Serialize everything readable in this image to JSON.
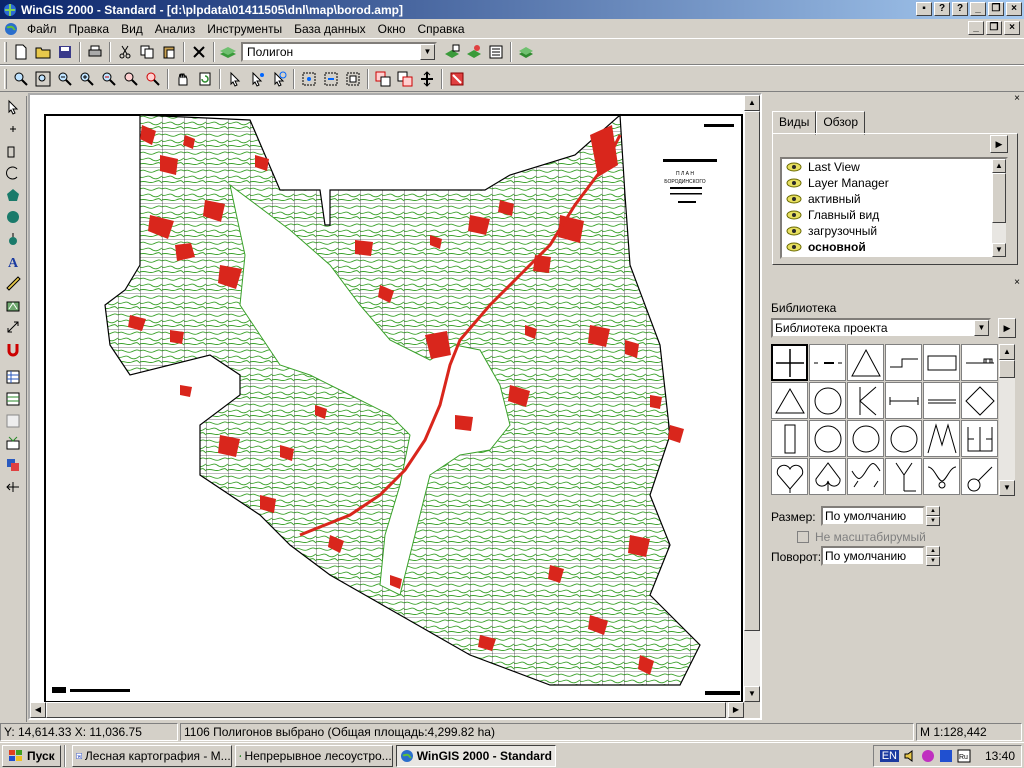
{
  "window": {
    "title": "WinGIS 2000 - Standard - [d:\\plpdata\\01411505\\dnl\\map\\borod.amp]"
  },
  "menu": [
    "Файл",
    "Правка",
    "Вид",
    "Анализ",
    "Инструменты",
    "База данных",
    "Окно",
    "Справка"
  ],
  "toolbar": {
    "layer_combo_value": "Полигон"
  },
  "map": {
    "title_line1": "П Л А Н",
    "title_line2": "БОРОДИНСКОГО"
  },
  "views_panel": {
    "tabs": [
      "Виды",
      "Обзор"
    ],
    "items": [
      {
        "label": "Last View",
        "bold": false
      },
      {
        "label": "Layer Manager",
        "bold": false
      },
      {
        "label": "активный",
        "bold": false
      },
      {
        "label": "Главный вид",
        "bold": false
      },
      {
        "label": "загрузочный",
        "bold": false
      },
      {
        "label": "основной",
        "bold": true
      }
    ]
  },
  "library_panel": {
    "label": "Библиотека",
    "combo_value": "Библиотека проекта",
    "size_label": "Размер:",
    "size_value": "По умолчанию",
    "no_scale_label": "Не масштабирумый",
    "rotation_label": "Поворот:",
    "rotation_value": "По умолчанию"
  },
  "status": {
    "coords": "Y: 14,614.33 X: 11,036.75",
    "selection": "1106 Полигонов выбрано (Общая площадь:4,299.82 ha)",
    "scale": "M 1:128,442"
  },
  "taskbar": {
    "start": "Пуск",
    "tasks": [
      "Лесная картография - М...",
      "Непрерывное лесоустро...",
      "WinGIS 2000 - Standard"
    ],
    "lang": "EN",
    "clock": "13:40"
  },
  "colors": {
    "titlebar_start": "#0a246a",
    "forest_green": "#3aa12a",
    "polygon_red": "#d9261c"
  }
}
